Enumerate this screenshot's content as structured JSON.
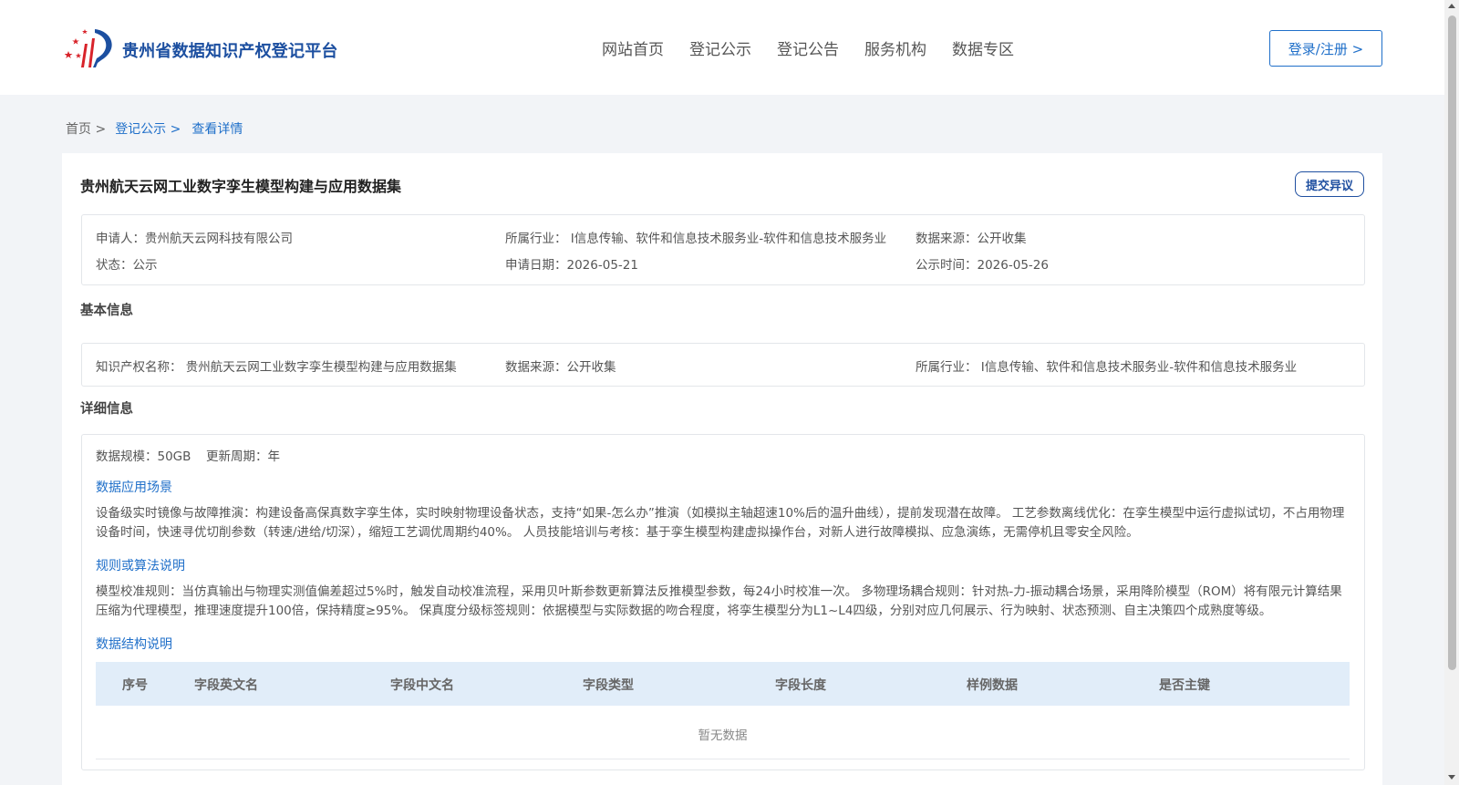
{
  "header": {
    "logo_text": "贵州省数据知识产权登记平台",
    "nav": [
      "网站首页",
      "登记公示",
      "登记公告",
      "服务机构",
      "数据专区"
    ],
    "login_label": "登录/注册 >"
  },
  "breadcrumb": {
    "home": "首页 >",
    "section": "登记公示 >",
    "current": "查看详情"
  },
  "detail": {
    "title": "贵州航天云网工业数字孪生模型构建与应用数据集",
    "dispute_label": "提交异议",
    "summary": {
      "applicant": "申请人：贵州航天云网科技有限公司",
      "industry": "所属行业： I信息传输、软件和信息技术服务业-软件和信息技术服务业",
      "source": "数据来源：公开收集",
      "status": "状态：公示",
      "apply_date": "申请日期：2026-05-21",
      "publish_date": "公示时间：2026-05-26"
    },
    "basic_title": "基本信息",
    "basic": {
      "ip_name": "知识产权名称： 贵州航天云网工业数字孪生模型构建与应用数据集",
      "source": "数据来源：公开收集",
      "industry": "所属行业： I信息传输、软件和信息技术服务业-软件和信息技术服务业"
    },
    "detail_title": "详细信息",
    "scale": "数据规模：50GB",
    "cycle": "更新周期：年",
    "scenario_title": "数据应用场景",
    "scenario_text": "设备级实时镜像与故障推演：构建设备高保真数字孪生体，实时映射物理设备状态，支持“如果-怎么办”推演（如模拟主轴超速10%后的温升曲线），提前发现潜在故障。 工艺参数离线优化：在孪生模型中运行虚拟试切，不占用物理设备时间，快速寻优切削参数（转速/进给/切深），缩短工艺调优周期约40%。 人员技能培训与考核：基于孪生模型构建虚拟操作台，对新人进行故障模拟、应急演练，无需停机且零安全风险。",
    "rules_title": "规则或算法说明",
    "rules_text": "模型校准规则：当仿真输出与物理实测值偏差超过5%时，触发自动校准流程，采用贝叶斯参数更新算法反推模型参数，每24小时校准一次。 多物理场耦合规则：针对热-力-振动耦合场景，采用降阶模型（ROM）将有限元计算结果压缩为代理模型，推理速度提升100倍，保持精度≥95%。 保真度分级标签规则：依据模型与实际数据的吻合程度，将孪生模型分为L1~L4四级，分别对应几何展示、行为映射、状态预测、自主决策四个成熟度等级。",
    "structure_title": "数据结构说明",
    "table_headers": [
      "序号",
      "字段英文名",
      "字段中文名",
      "字段类型",
      "字段长度",
      "样例数据",
      "是否主键"
    ],
    "empty_text": "暂无数据"
  },
  "colors": {
    "brand": "#1c4fa0",
    "link": "#1f6fc9",
    "table_header_bg": "#e1edf9"
  }
}
